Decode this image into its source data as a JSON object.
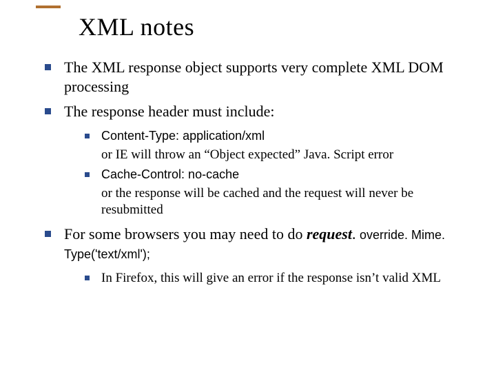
{
  "title": "XML notes",
  "bullets": {
    "b1": "The XML response object supports very complete XML DOM processing",
    "b2": "The response header must include:",
    "b2_sub": {
      "s1_code": "Content-Type: application/xml",
      "s1_note": "or IE will throw an “Object expected” Java. Script error",
      "s2_code": "Cache-Control: no-cache",
      "s2_note": "or the response will be cached and the request will never be resubmitted"
    },
    "b3_pre": "For some browsers you may need to do ",
    "b3_req": "request",
    "b3_dot": ". ",
    "b3_code": "override. Mime. Type('text/xml');",
    "b3_sub": {
      "s1": "In Firefox, this will give an error if the response isn’t valid XML"
    }
  }
}
